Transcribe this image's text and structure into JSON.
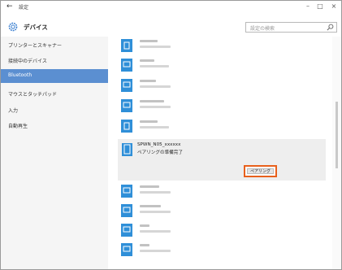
{
  "window": {
    "title": "設定",
    "back_icon": "←",
    "minimize": "–",
    "maximize": "□",
    "close": "×"
  },
  "header": {
    "title": "デバイス",
    "icon": "gear-icon"
  },
  "search": {
    "placeholder": "設定の検索",
    "icon": "search-icon"
  },
  "sidebar": {
    "items": [
      {
        "label": "プリンターとスキャナー",
        "selected": false
      },
      {
        "label": "接続中のデバイス",
        "selected": false
      },
      {
        "label": "Bluetooth",
        "selected": true
      },
      {
        "label": "マウスとタッチパッド",
        "selected": false
      },
      {
        "label": "入力",
        "selected": false
      },
      {
        "label": "自動再生",
        "selected": false
      }
    ]
  },
  "selected_device": {
    "name": "SPWN_N05_xxxxxx",
    "status": "ペアリングの準備完了",
    "pair_button_label": "ペアリング"
  },
  "colors": {
    "accent": "#5b8fd1",
    "highlight_outline": "#e8601c",
    "device_icon": "#2f8fd8"
  }
}
